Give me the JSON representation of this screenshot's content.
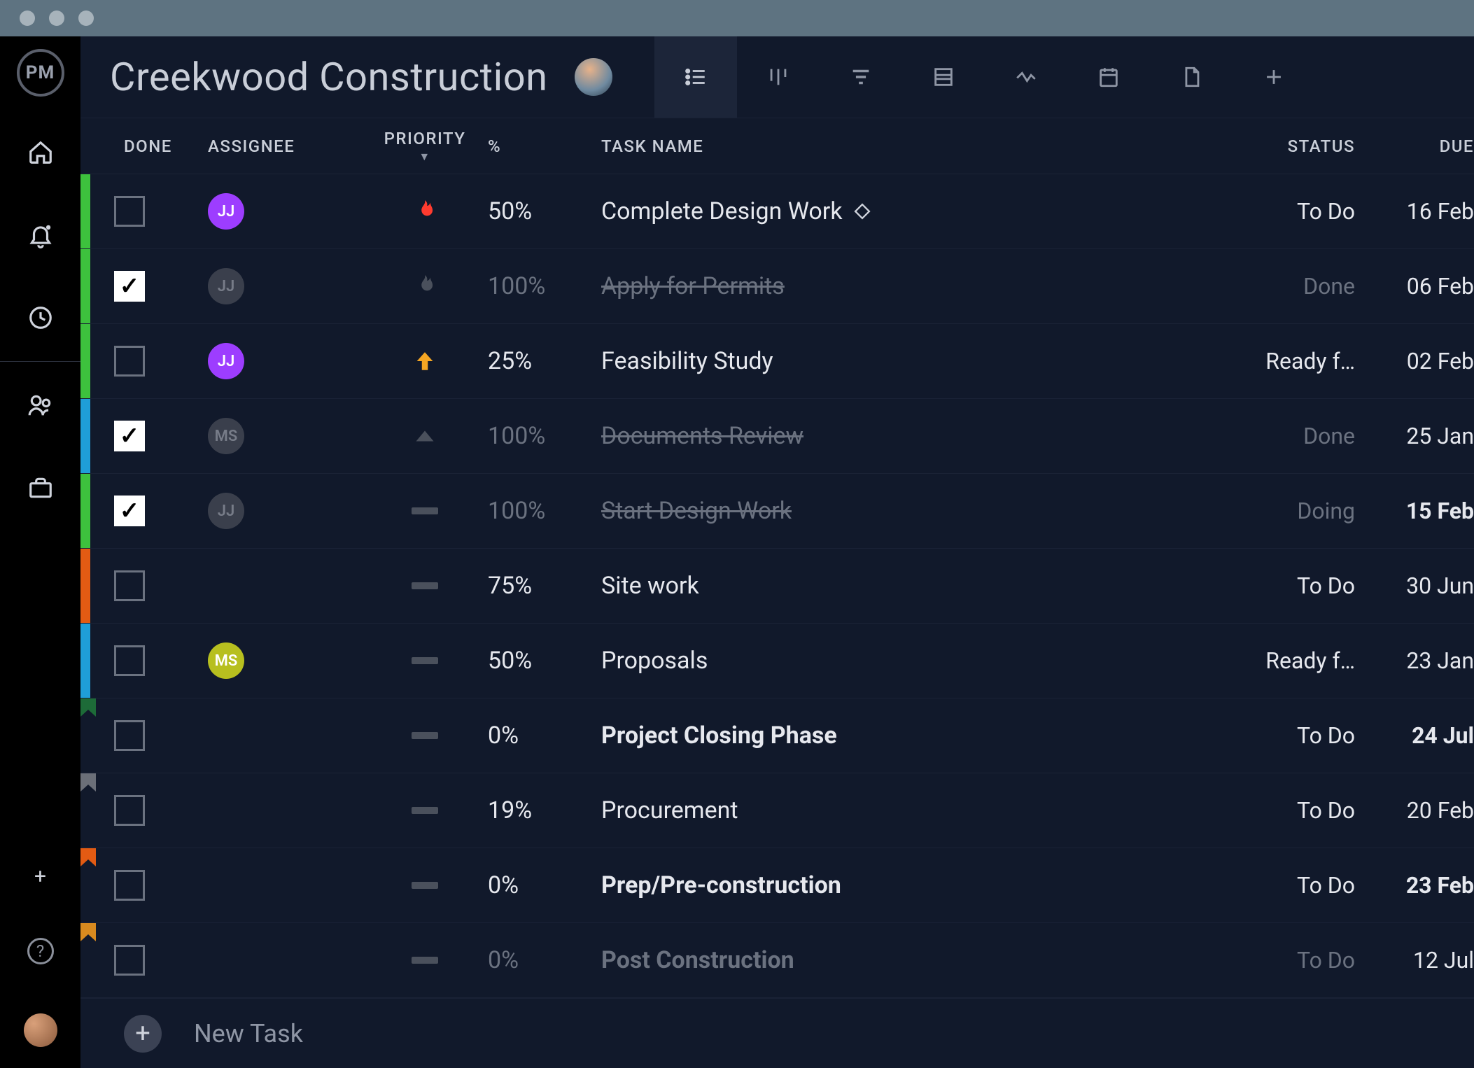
{
  "project": {
    "title": "Creekwood Construction"
  },
  "columns": {
    "done": "DONE",
    "assignee": "ASSIGNEE",
    "priority": "PRIORITY",
    "percent": "%",
    "task_name": "TASK NAME",
    "status": "STATUS",
    "due": "DUE"
  },
  "footer": {
    "new_task": "New Task"
  },
  "assignees": {
    "jj": "JJ",
    "ms": "MS"
  },
  "tasks": [
    {
      "stripe": "#3dc13d",
      "done": false,
      "assignee": "jj",
      "assigneeDim": false,
      "priority": "fire",
      "priorityDim": false,
      "pct": "50%",
      "pctDim": false,
      "name": "Complete Design Work",
      "milestone": true,
      "nameStyle": "",
      "status": "To Do",
      "statusDim": false,
      "due": "16 Feb",
      "dueBold": false
    },
    {
      "stripe": "#3dc13d",
      "done": true,
      "assignee": "jj",
      "assigneeDim": true,
      "priority": "fire",
      "priorityDim": true,
      "pct": "100%",
      "pctDim": true,
      "name": "Apply for Permits",
      "milestone": false,
      "nameStyle": "done",
      "status": "Done",
      "statusDim": true,
      "due": "06 Feb",
      "dueBold": false
    },
    {
      "stripe": "#3dc13d",
      "done": false,
      "assignee": "jj",
      "assigneeDim": false,
      "priority": "arrow",
      "priorityDim": false,
      "pct": "25%",
      "pctDim": false,
      "name": "Feasibility Study",
      "milestone": false,
      "nameStyle": "",
      "status": "Ready f…",
      "statusDim": false,
      "due": "02 Feb",
      "dueBold": false
    },
    {
      "stripe": "#1f9ed8",
      "done": true,
      "assignee": "ms",
      "assigneeDim": true,
      "priority": "caret",
      "priorityDim": true,
      "pct": "100%",
      "pctDim": true,
      "name": "Documents Review",
      "milestone": false,
      "nameStyle": "done",
      "status": "Done",
      "statusDim": true,
      "due": "25 Jan",
      "dueBold": false
    },
    {
      "stripe": "#3dc13d",
      "done": true,
      "assignee": "jj",
      "assigneeDim": true,
      "priority": "minus",
      "priorityDim": true,
      "pct": "100%",
      "pctDim": true,
      "name": "Start Design Work",
      "milestone": false,
      "nameStyle": "done",
      "status": "Doing",
      "statusDim": true,
      "due": "15 Feb",
      "dueBold": true
    },
    {
      "stripe": "#e35b13",
      "done": false,
      "assignee": "",
      "assigneeDim": false,
      "priority": "minus",
      "priorityDim": false,
      "pct": "75%",
      "pctDim": false,
      "name": "Site work",
      "milestone": false,
      "nameStyle": "",
      "status": "To Do",
      "statusDim": false,
      "due": "30 Jun",
      "dueBold": false
    },
    {
      "stripe": "#1f9ed8",
      "done": false,
      "assignee": "ms",
      "assigneeDim": false,
      "priority": "minus",
      "priorityDim": false,
      "pct": "50%",
      "pctDim": false,
      "name": "Proposals",
      "milestone": false,
      "nameStyle": "",
      "status": "Ready f…",
      "statusDim": false,
      "due": "23 Jan",
      "dueBold": false
    },
    {
      "stripe": "",
      "flag": "#1d6b38",
      "done": false,
      "assignee": "",
      "assigneeDim": false,
      "priority": "minus",
      "priorityDim": false,
      "pct": "0%",
      "pctDim": false,
      "name": "Project Closing Phase",
      "milestone": false,
      "nameStyle": "bold",
      "status": "To Do",
      "statusDim": false,
      "due": "24 Jul",
      "dueBold": true
    },
    {
      "stripe": "",
      "flag": "#6b6f78",
      "done": false,
      "assignee": "",
      "assigneeDim": false,
      "priority": "minus",
      "priorityDim": false,
      "pct": "19%",
      "pctDim": false,
      "name": "Procurement",
      "milestone": false,
      "nameStyle": "",
      "status": "To Do",
      "statusDim": false,
      "due": "20 Feb",
      "dueBold": false
    },
    {
      "stripe": "",
      "flag": "#e35b13",
      "done": false,
      "assignee": "",
      "assigneeDim": false,
      "priority": "minus",
      "priorityDim": false,
      "pct": "0%",
      "pctDim": false,
      "name": "Prep/Pre-construction",
      "milestone": false,
      "nameStyle": "bold",
      "status": "To Do",
      "statusDim": false,
      "due": "23 Feb",
      "dueBold": true
    },
    {
      "stripe": "",
      "flag": "#d88a1f",
      "done": false,
      "assignee": "",
      "assigneeDim": false,
      "priority": "minus",
      "priorityDim": true,
      "pct": "0%",
      "pctDim": true,
      "name": "Post Construction",
      "milestone": false,
      "nameStyle": "faded",
      "status": "To Do",
      "statusDim": true,
      "due": "12 Jul",
      "dueBold": false
    }
  ]
}
